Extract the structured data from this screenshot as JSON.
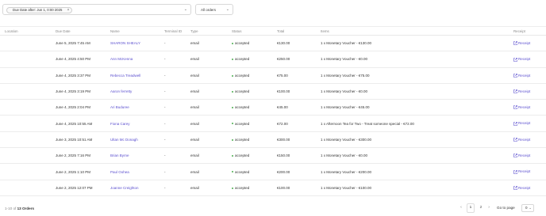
{
  "filter": {
    "chip_label": "Due Date after: Jun 1, 0:00 2025",
    "chip_close": "×",
    "dropdown_glyph": "⌄"
  },
  "orders_select": {
    "label": "All orders",
    "dropdown_glyph": "⌄"
  },
  "table": {
    "headers": {
      "location": "Location",
      "due_date": "Due Date",
      "name": "Name",
      "terminal": "Terminal ID",
      "type": "Type",
      "status": "Status",
      "total": "Total",
      "items": "Items",
      "receipt": "Receipt"
    },
    "rows": [
      {
        "location": "",
        "due_date": "June 5, 2025 7:45 AM",
        "name": "SHARON SHEALY",
        "terminal": "-",
        "type": "email",
        "status": "accepted",
        "total": "€130.00",
        "items": "1 x Monetary Voucher - €130.00",
        "receipt": "Receipt"
      },
      {
        "location": "",
        "due_date": "June 4, 2025 4:50 PM",
        "name": "Ann McKenna",
        "terminal": "-",
        "type": "email",
        "status": "accepted",
        "total": "€250.00",
        "items": "1 x Monetary Voucher - €0.00",
        "receipt": "Receipt"
      },
      {
        "location": "",
        "due_date": "June 4, 2025 3:37 PM",
        "name": "Rebecca Treadwell",
        "terminal": "-",
        "type": "email",
        "status": "accepted",
        "total": "€75.00",
        "items": "1 x Monetary Voucher - €75.00",
        "receipt": "Receipt"
      },
      {
        "location": "",
        "due_date": "June 4, 2025 3:19 PM",
        "name": "Aaron ferretty",
        "terminal": "-",
        "type": "email",
        "status": "accepted",
        "total": "€100.00",
        "items": "1 x Monetary Voucher - €0.00",
        "receipt": "Receipt"
      },
      {
        "location": "",
        "due_date": "June 4, 2025 2:04 PM",
        "name": "Ari Buduree",
        "terminal": "-",
        "type": "email",
        "status": "accepted",
        "total": "€45.00",
        "items": "1 x Monetary Voucher - €45.00",
        "receipt": "Receipt"
      },
      {
        "location": "",
        "due_date": "June 4, 2025 10:55 AM",
        "name": "Fiona Carey",
        "terminal": "-",
        "type": "email",
        "status": "accepted",
        "total": "€72.00",
        "items": "1 x Afternoon Tea for Two - Treat someone special - €72.00",
        "receipt": "Receipt"
      },
      {
        "location": "",
        "due_date": "June 3, 2025 10:51 AM",
        "name": "Ultan Mc Donagh",
        "terminal": "-",
        "type": "email",
        "status": "accepted",
        "total": "€300.00",
        "items": "1 x Monetary Voucher - €300.00",
        "receipt": "Receipt"
      },
      {
        "location": "",
        "due_date": "June 2, 2025 7:16 PM",
        "name": "Brian Byrne",
        "terminal": "-",
        "type": "email",
        "status": "accepted",
        "total": "€150.00",
        "items": "1 x Monetary Voucher - €0.00",
        "receipt": "Receipt"
      },
      {
        "location": "",
        "due_date": "June 2, 2025 1:10 PM",
        "name": "Paul Oohea",
        "terminal": "-",
        "type": "email",
        "status": "accepted",
        "total": "€200.00",
        "items": "1 x Monetary Voucher - €200.00",
        "receipt": "Receipt"
      },
      {
        "location": "",
        "due_date": "June 2, 2025 12:07 PM",
        "name": "Joanne Creighton",
        "terminal": "-",
        "type": "email",
        "status": "accepted",
        "total": "€100.00",
        "items": "1 x Monetary Voucher - €100.00",
        "receipt": "Receipt"
      }
    ]
  },
  "footer": {
    "range": "1-10 of",
    "total_orders": "13 Orders",
    "prev_glyph": "‹",
    "page_1": "1",
    "page_2": "2",
    "next_glyph": "›",
    "goto_label": "Go to page",
    "goto_value": "0",
    "goto_dropdown": "⌄"
  },
  "colors": {
    "link": "#5b4fcf",
    "status_dot": "#4caf50",
    "border": "#d8d8d8"
  }
}
